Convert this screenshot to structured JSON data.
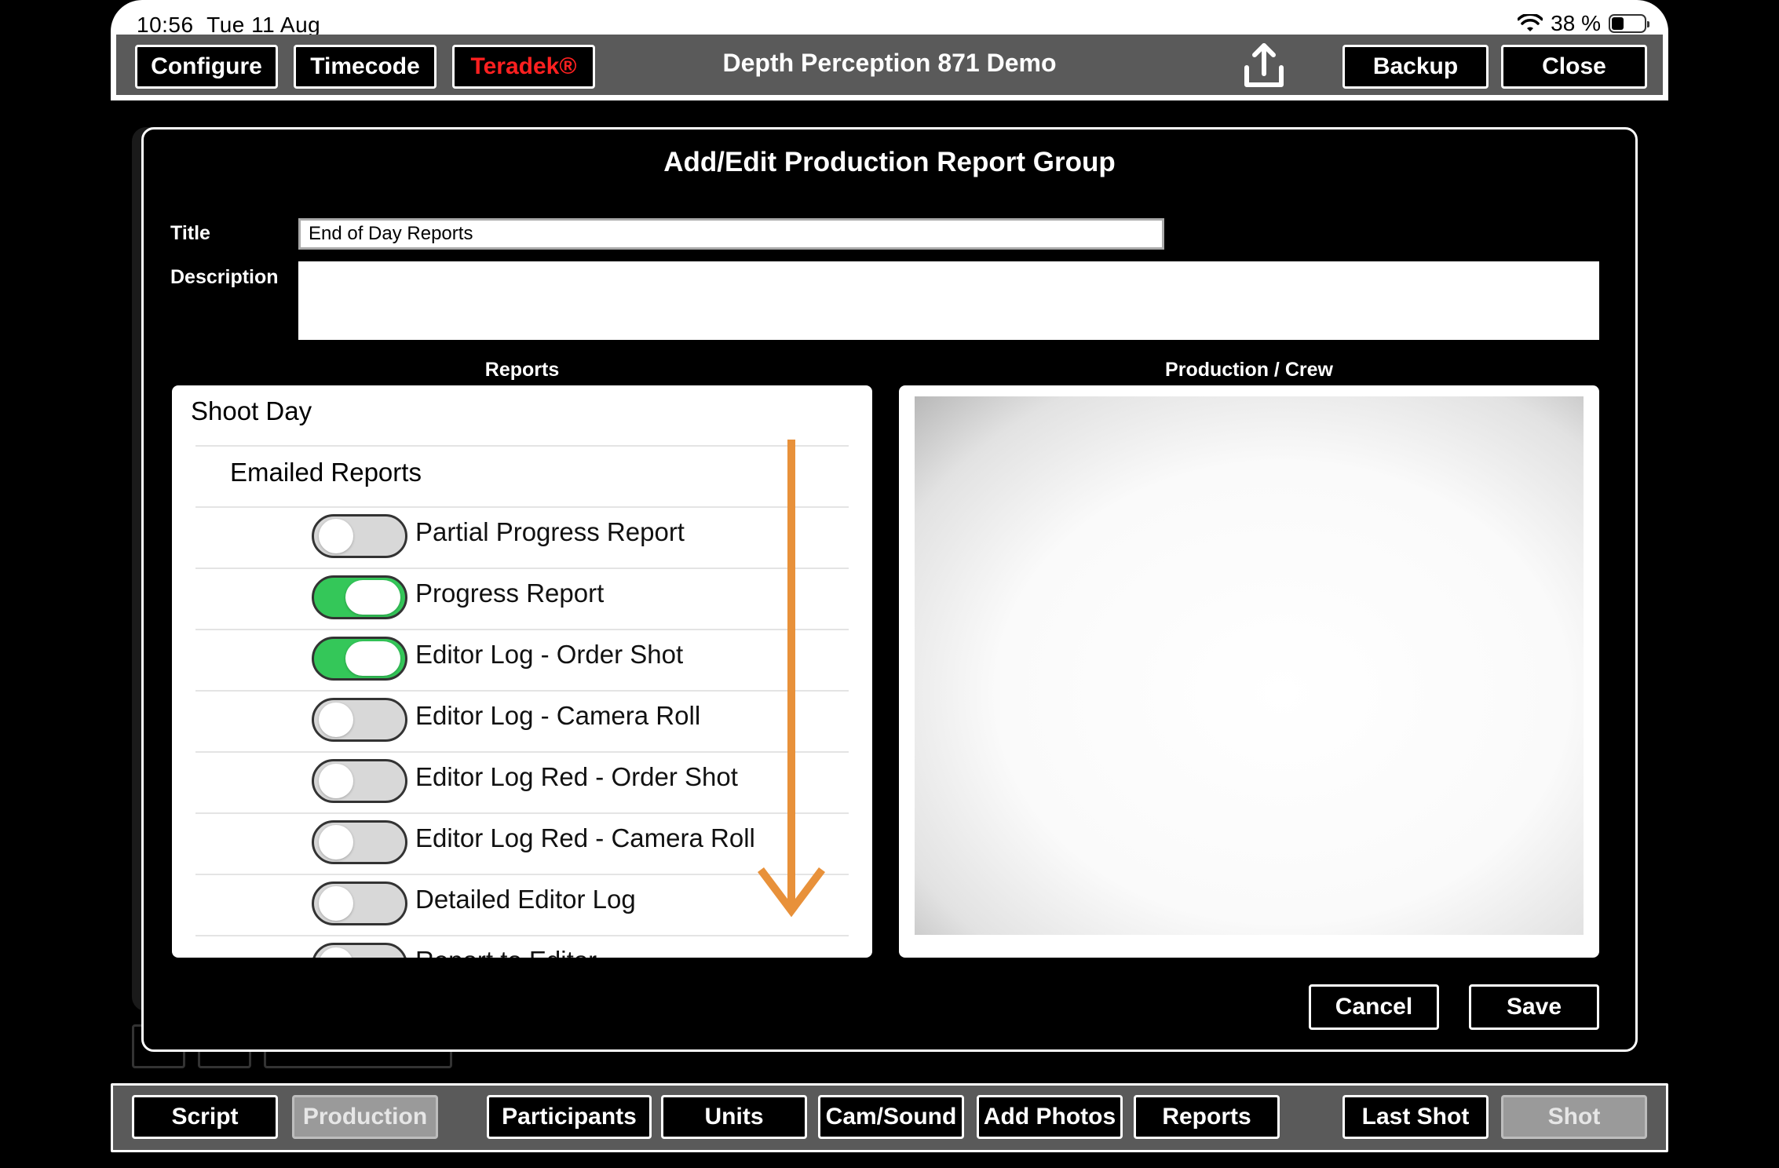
{
  "status": {
    "time": "10:56",
    "date": "Tue 11 Aug",
    "battery": "38 %",
    "battery_level": 0.38
  },
  "topbar": {
    "title": "Depth Perception 871 Demo",
    "configure": "Configure",
    "timecode": "Timecode",
    "teradek": "Teradek®",
    "backup": "Backup",
    "close": "Close"
  },
  "modal": {
    "title": "Add/Edit Production Report Group",
    "title_label": "Title",
    "title_value": "End of Day Reports",
    "description_label": "Description",
    "description_value": "",
    "reports_header": "Reports",
    "crew_header": "Production / Crew",
    "group1": "Shoot Day",
    "group2": "Emailed Reports",
    "reports": [
      {
        "label": "Partial Progress Report",
        "on": false
      },
      {
        "label": "Progress Report",
        "on": true
      },
      {
        "label": "Editor Log - Order Shot",
        "on": true
      },
      {
        "label": "Editor Log - Camera Roll",
        "on": false
      },
      {
        "label": "Editor Log Red - Order Shot",
        "on": false
      },
      {
        "label": "Editor Log Red - Camera Roll",
        "on": false
      },
      {
        "label": "Detailed Editor Log",
        "on": false
      },
      {
        "label": "Report to Editor",
        "on": false
      }
    ],
    "cancel": "Cancel",
    "save": "Save"
  },
  "colors": {
    "toggle_on": "#34c759",
    "accent_red": "#ff2020",
    "arrow": "#e8913a"
  },
  "bottombar": {
    "script": "Script",
    "production": "Production",
    "participants": "Participants",
    "units": "Units",
    "cam_sound": "Cam/Sound",
    "add_photos": "Add Photos",
    "reports": "Reports",
    "last_shot": "Last Shot",
    "shot": "Shot"
  }
}
